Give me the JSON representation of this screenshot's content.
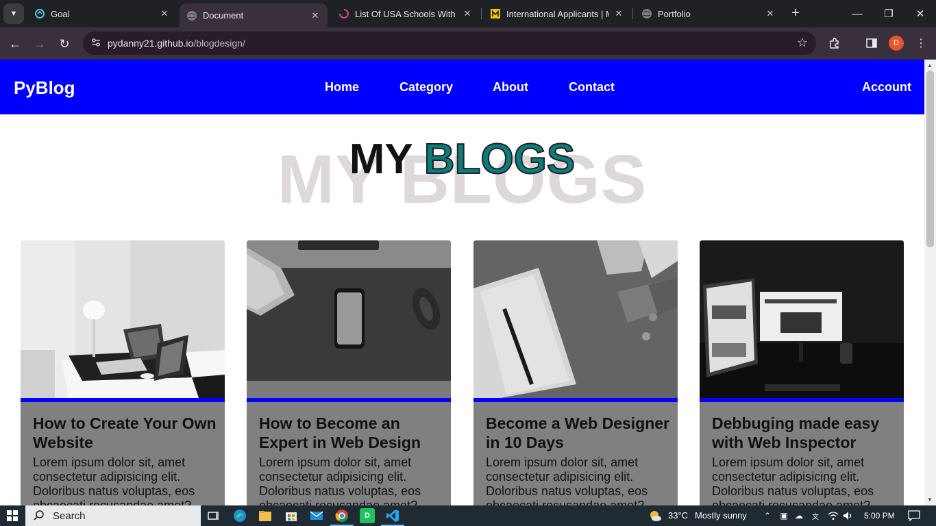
{
  "browser": {
    "tabs": [
      {
        "title": "Goal",
        "icon": "goal-favicon"
      },
      {
        "title": "Document",
        "icon": "globe-icon",
        "active": true
      },
      {
        "title": "List Of USA Schools With No",
        "icon": "spinner-favicon"
      },
      {
        "title": "International Applicants | Mi",
        "icon": "university-favicon"
      },
      {
        "title": "Portfolio",
        "icon": "globe-icon"
      }
    ],
    "address": {
      "domain": "pydanny21.github.io",
      "path": "/blogdesign/"
    },
    "profile_initial": "D"
  },
  "site": {
    "logo": "PyBlog",
    "nav": [
      "Home",
      "Category",
      "About",
      "Contact"
    ],
    "account": "Account",
    "heading": {
      "word1": "MY",
      "word2": "BLOGS",
      "shadow": "MY BLOGS"
    },
    "colors": {
      "header": "#0000ff",
      "card": "#808080",
      "accent_bar": "#0000ff",
      "heading_accent": "#0e7b7b"
    },
    "cards": [
      {
        "title": "How to Create Your Own Website",
        "description": "Lorem ipsum dolor sit, amet consectetur adipisicing elit. Doloribus natus voluptas, eos obcaecati recusandae amet?",
        "image": "desk-laptop-tablet-photo"
      },
      {
        "title": "How to Become an Expert in Web Design",
        "description": "Lorem ipsum dolor sit, amet consectetur adipisicing elit. Doloribus natus voluptas, eos obcaecati recusandae amet?",
        "image": "phone-keyboard-mouse-photo"
      },
      {
        "title": "Become a Web Designer in 10 Days",
        "description": "Lorem ipsum dolor sit, amet consectetur adipisicing elit. Doloribus natus voluptas, eos obcaecati recusandae amet?",
        "image": "notebook-pen-envelopes-photo"
      },
      {
        "title": "Debbuging made easy with Web Inspector",
        "description": "Lorem ipsum dolor sit, amet consectetur adipisicing elit. Doloribus natus voluptas, eos obcaecati recusandae amet?",
        "image": "monitors-newspaper-photo"
      }
    ]
  },
  "taskbar": {
    "search_placeholder": "Search",
    "weather": {
      "temp": "33°C",
      "condition": "Mostly sunny"
    },
    "time": "5:00 PM"
  }
}
